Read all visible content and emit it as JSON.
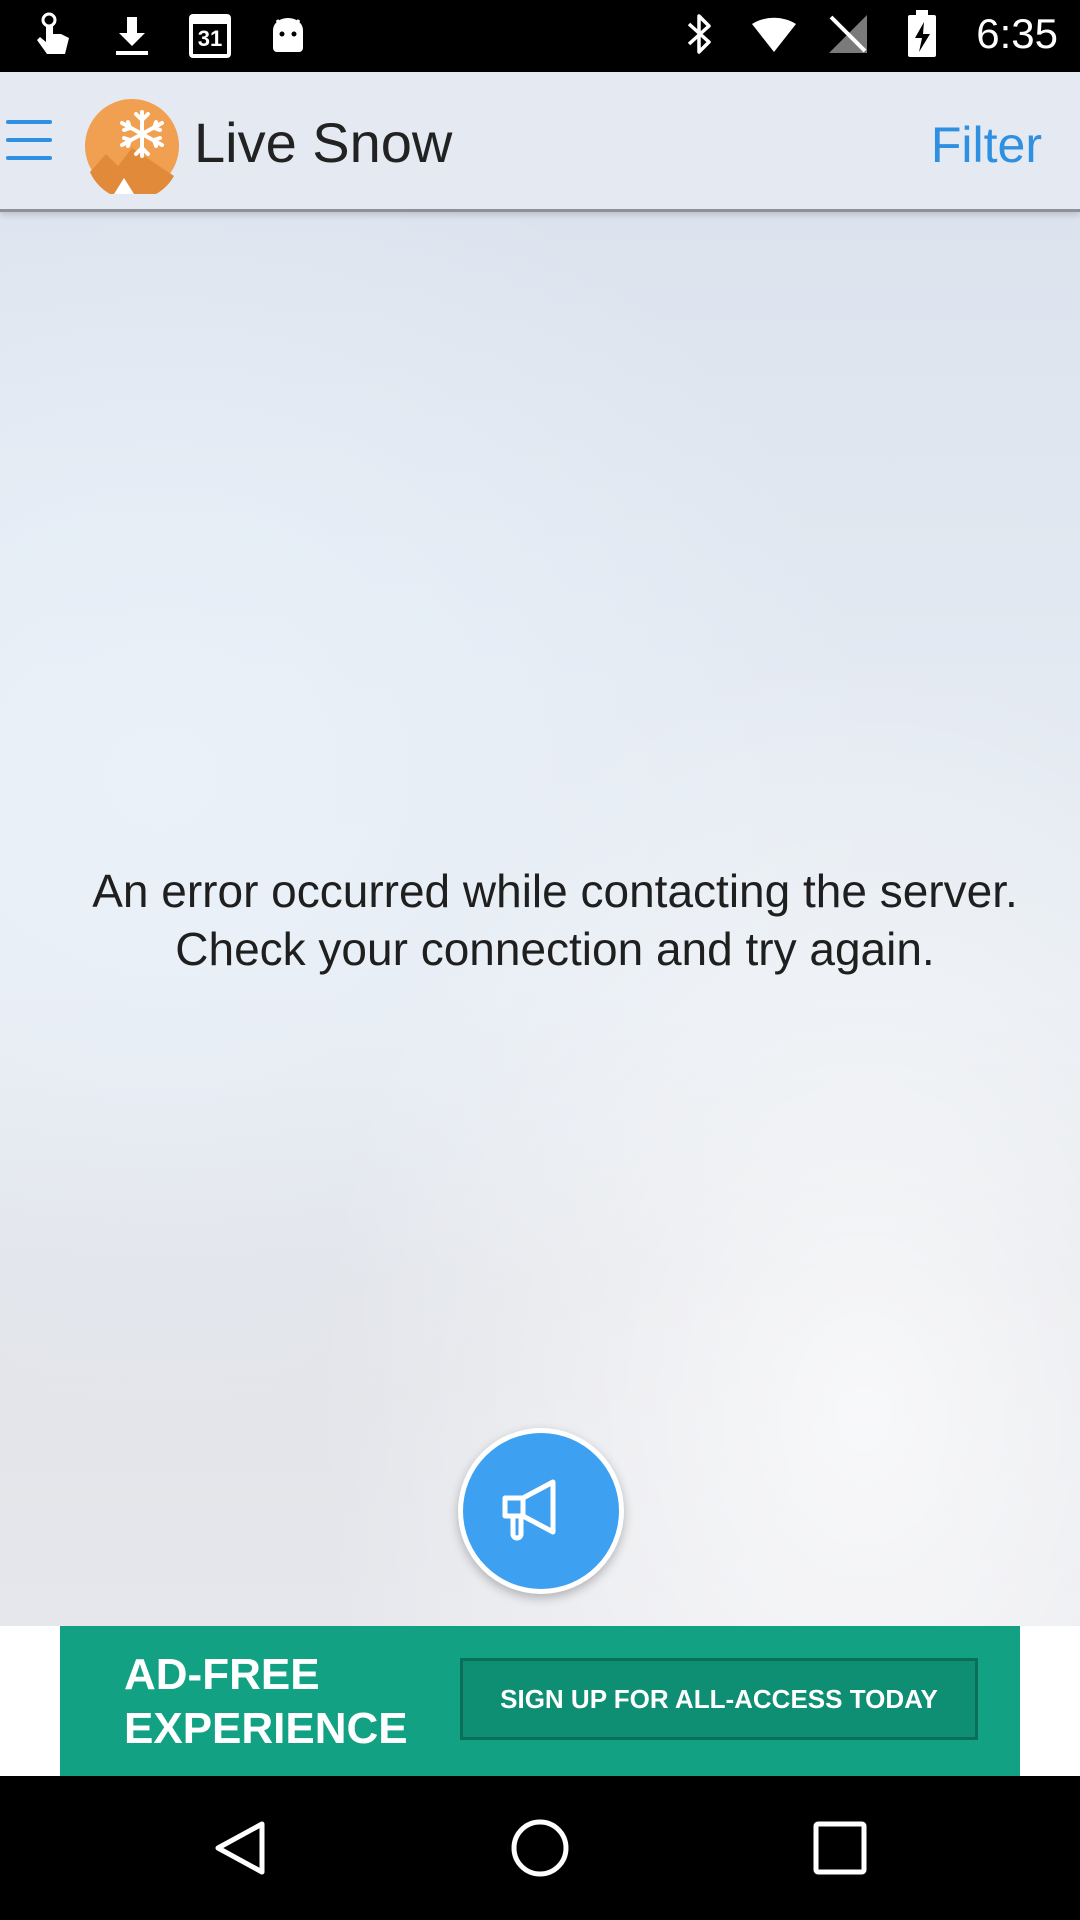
{
  "status_bar": {
    "time": "6:35",
    "calendar_day": "31",
    "left_icons": [
      "touch-icon",
      "download-icon",
      "calendar-icon",
      "android-icon"
    ],
    "right_icons": [
      "bluetooth-icon",
      "wifi-icon",
      "no-signal-icon",
      "battery-charging-icon"
    ]
  },
  "app_bar": {
    "title": "Live Snow",
    "filter_label": "Filter",
    "menu_icon": "hamburger-menu-icon",
    "logo_icon": "snowflake-mountain-logo"
  },
  "main": {
    "error_line1": "An error occurred while contacting the server.",
    "error_line2": "Check your connection and try again.",
    "fab_icon": "megaphone-icon"
  },
  "ad": {
    "headline_line1": "AD-FREE",
    "headline_line2": "EXPERIENCE",
    "cta_label": "SIGN UP FOR ALL-ACCESS TODAY"
  },
  "nav_bar": {
    "buttons": [
      "back-icon",
      "home-icon",
      "recents-icon"
    ]
  },
  "colors": {
    "accent_blue": "#2f8fe0",
    "fab_blue": "#3ea0f0",
    "ad_green": "#12a283",
    "logo_orange": "#f0a050"
  }
}
